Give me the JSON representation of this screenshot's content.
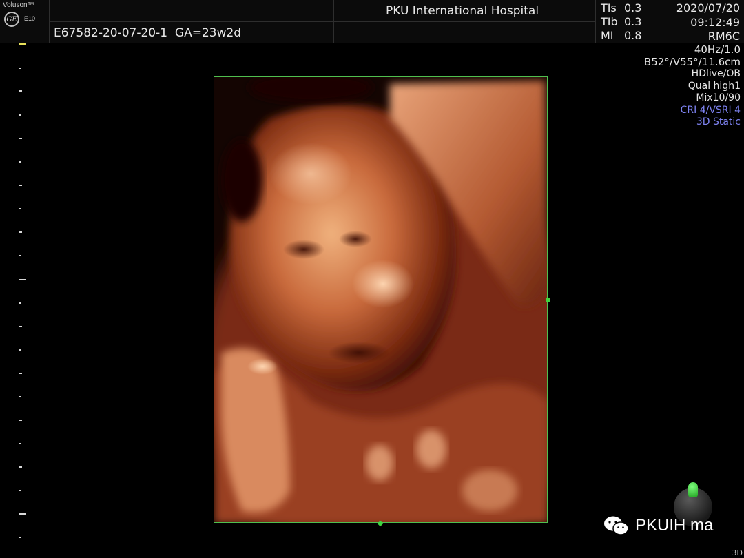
{
  "header": {
    "brand": "Voluson™",
    "logo_text": "GE",
    "model": "E10",
    "exam_id": "E67582-20-07-20-1",
    "gestational_age": "GA=23w2d",
    "hospital": "PKU International Hospital",
    "safety": [
      {
        "label": "TIs",
        "value": "0.3"
      },
      {
        "label": "TIb",
        "value": "0.3"
      },
      {
        "label": "MI",
        "value": "0.8"
      }
    ],
    "date": "2020/07/20",
    "time": "09:12:49",
    "probe": "RM6C"
  },
  "params": {
    "frame_rate": "40Hz/1.0",
    "angles": "B52°/V55°/11.6cm",
    "render_mode": "HDlive/OB",
    "quality": "Qual high1",
    "mix": "Mix10/90",
    "cri": "CRI 4/VSRI 4",
    "static_mode": "3D Static"
  },
  "render": {
    "description_icon": "fetal-face-3d-render",
    "border_color": "#4fbf4f"
  },
  "overlay": {
    "watermark": "PKUIH ma",
    "mode_tag": "3D"
  },
  "colors": {
    "background": "#000000",
    "text": "#e6e6e6",
    "accent_blue": "#7d82f0",
    "frame_green": "#4fbf4f"
  }
}
